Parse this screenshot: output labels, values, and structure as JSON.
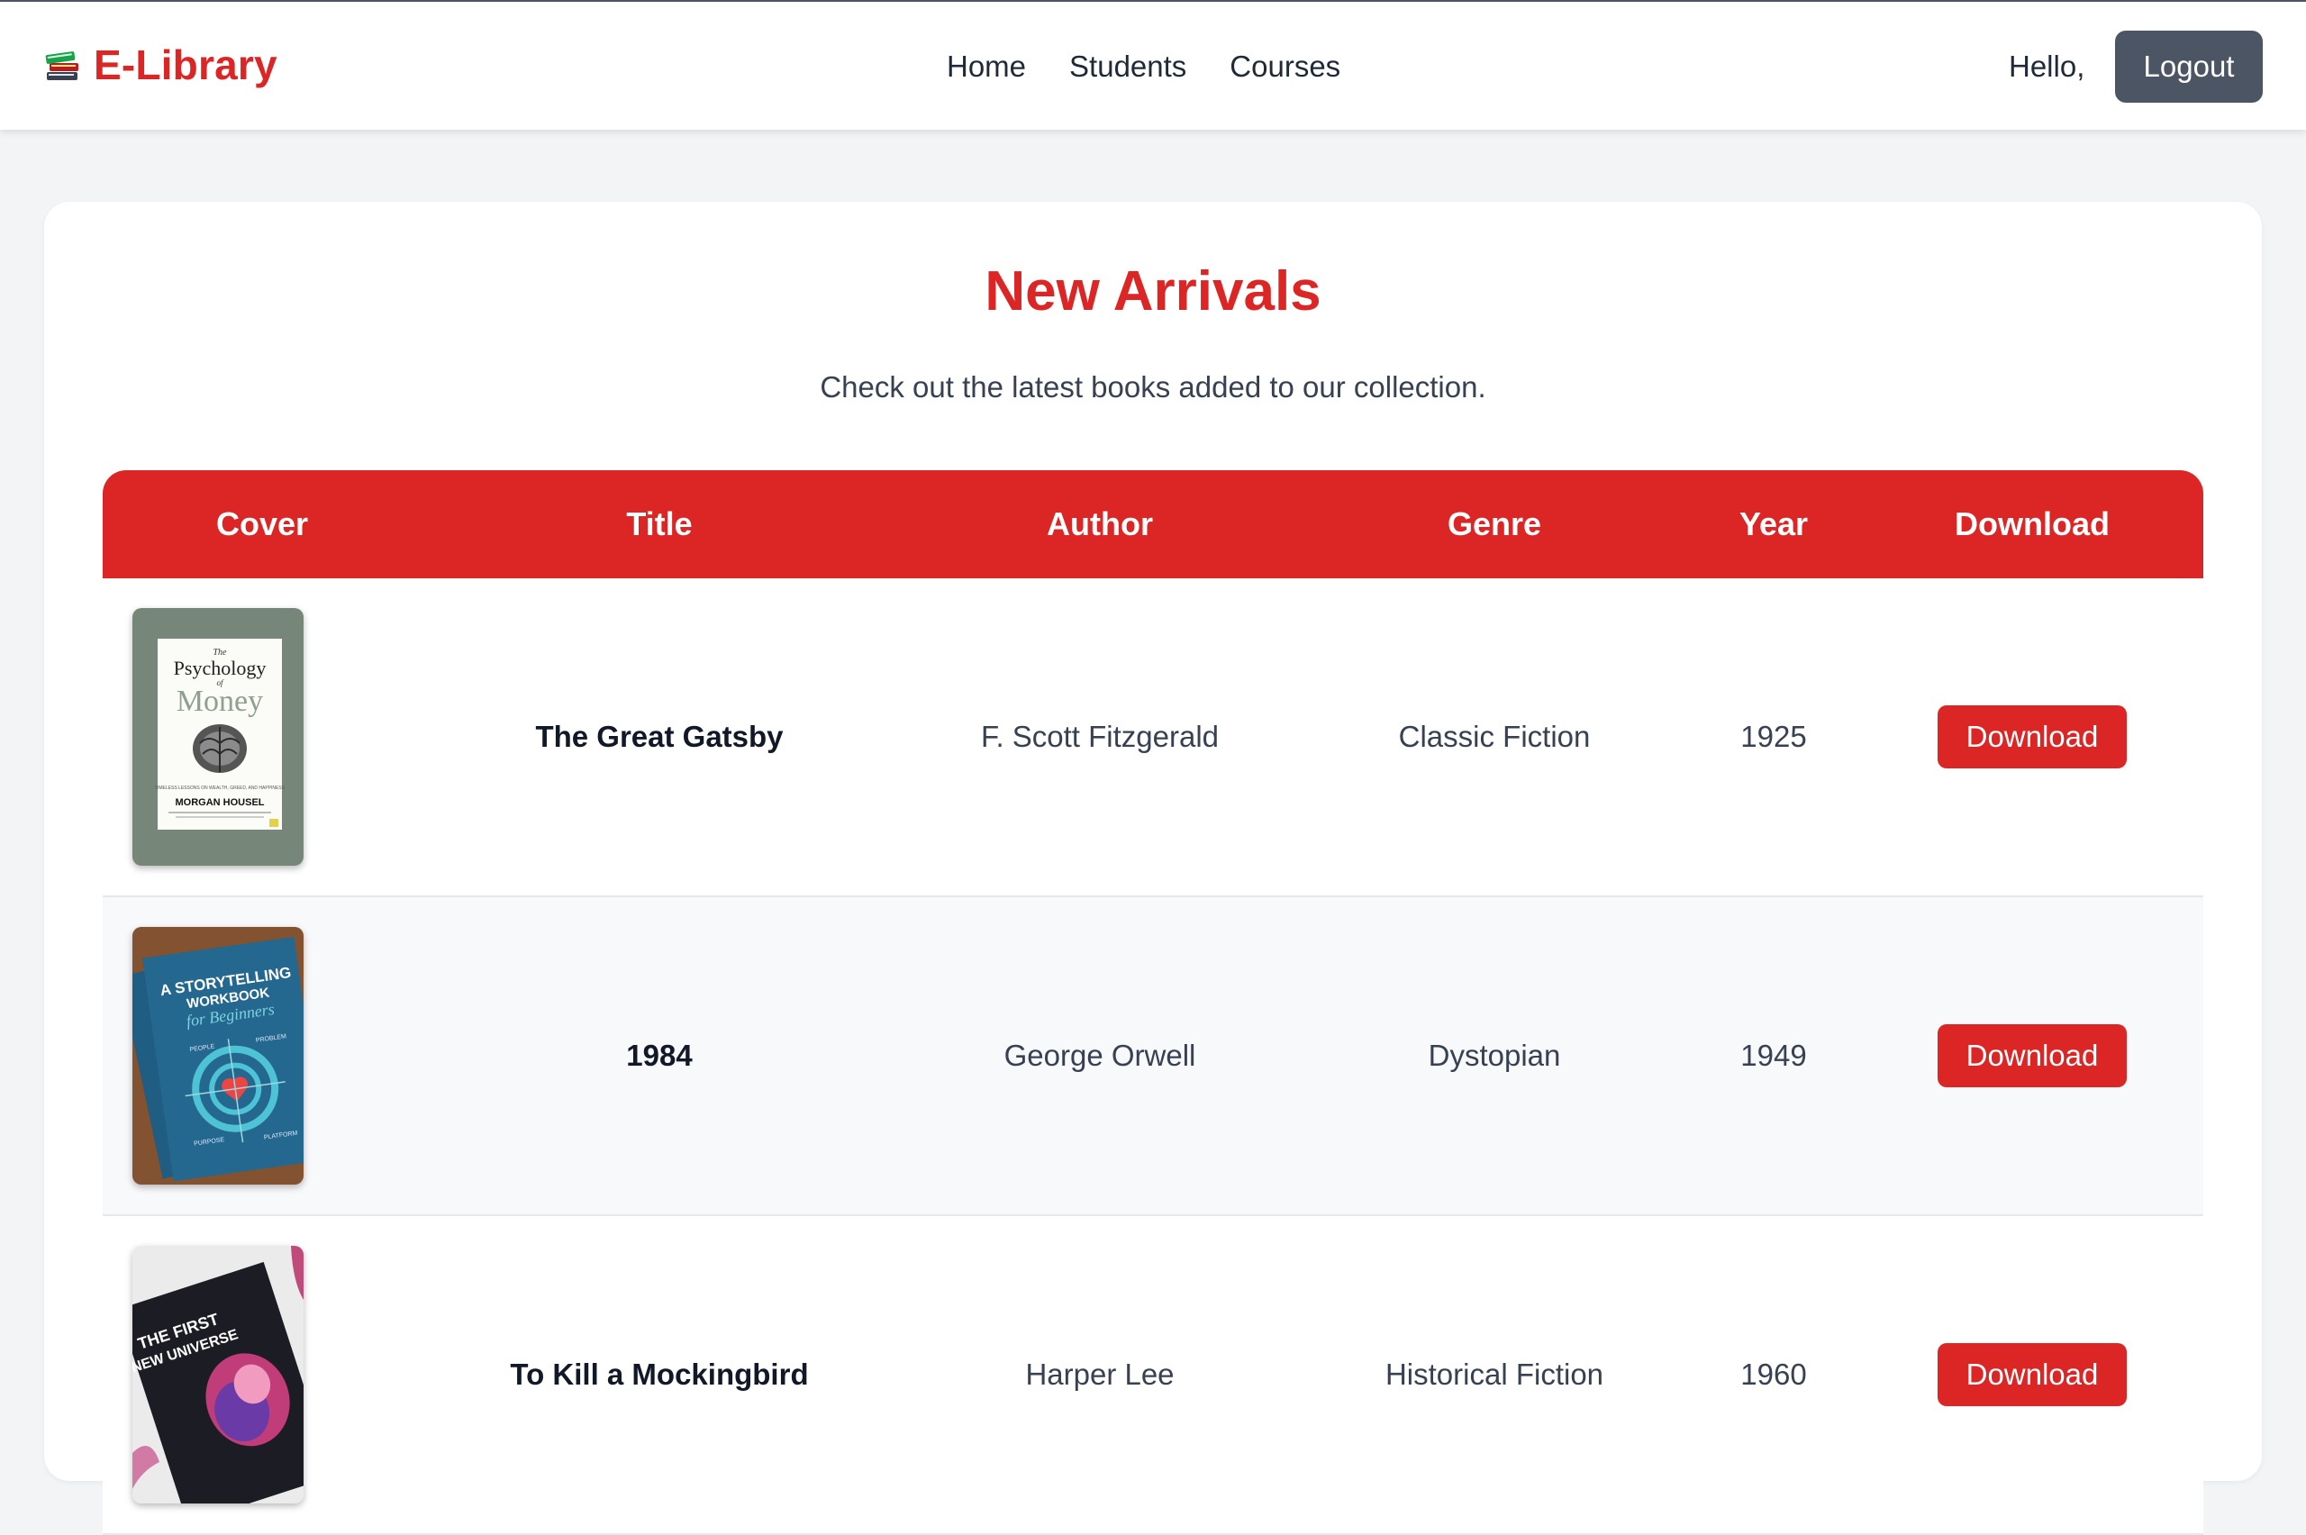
{
  "header": {
    "brand": "E-Library",
    "brand_icon": "books-icon",
    "nav": [
      "Home",
      "Students",
      "Courses"
    ],
    "greeting": "Hello,",
    "logout_label": "Logout"
  },
  "main": {
    "title": "New Arrivals",
    "subtitle": "Check out the latest books added to our collection."
  },
  "table": {
    "columns": [
      "Cover",
      "Title",
      "Author",
      "Genre",
      "Year",
      "Download"
    ],
    "rows": [
      {
        "cover": "cover-psychology-of-money",
        "title": "The Great Gatsby",
        "author": "F. Scott Fitzgerald",
        "genre": "Classic Fiction",
        "year": "1925",
        "download_label": "Download"
      },
      {
        "cover": "cover-storytelling-workbook",
        "title": "1984",
        "author": "George Orwell",
        "genre": "Dystopian",
        "year": "1949",
        "download_label": "Download"
      },
      {
        "cover": "cover-first-universe",
        "title": "To Kill a Mockingbird",
        "author": "Harper Lee",
        "genre": "Historical Fiction",
        "year": "1960",
        "download_label": "Download"
      }
    ]
  },
  "covers": {
    "psychology": {
      "line1": "The",
      "line2": "Psychology",
      "line3": "of",
      "line4": "Money",
      "tagline": "TIMELESS LESSONS ON WEALTH, GREED, AND HAPPINESS",
      "author": "MORGAN HOUSEL"
    },
    "storytelling": {
      "line1": "A STORYTELLING",
      "line2": "WORKBOOK",
      "line3": "for Beginners",
      "label_a": "PEOPLE",
      "label_b": "PROBLEM",
      "label_c": "PURPOSE",
      "label_d": "PLATFORM"
    },
    "universe": {
      "line1": "THE FIRST",
      "line2": "NEW UNIVERSE"
    }
  },
  "colors": {
    "accent": "#dc2626",
    "logout_bg": "#4b5563",
    "page_bg": "#f3f4f6"
  }
}
